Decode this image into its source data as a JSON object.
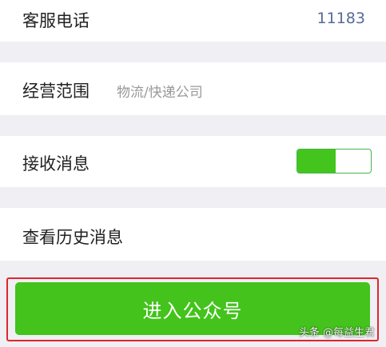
{
  "rows": {
    "phone": {
      "label": "客服电话",
      "value": "11183"
    },
    "scope": {
      "label": "经营范围",
      "value": "物流/快递公司"
    },
    "receive": {
      "label": "接收消息",
      "toggle_on": true
    },
    "history": {
      "label": "查看历史消息"
    }
  },
  "enter_button": {
    "label": "进入公众号"
  },
  "watermark": {
    "text": "头条 @每益生君"
  },
  "colors": {
    "background": "#efeff4",
    "accent_green": "#43c31c",
    "link_blue": "#576b95",
    "highlight_red": "#e0262b"
  }
}
